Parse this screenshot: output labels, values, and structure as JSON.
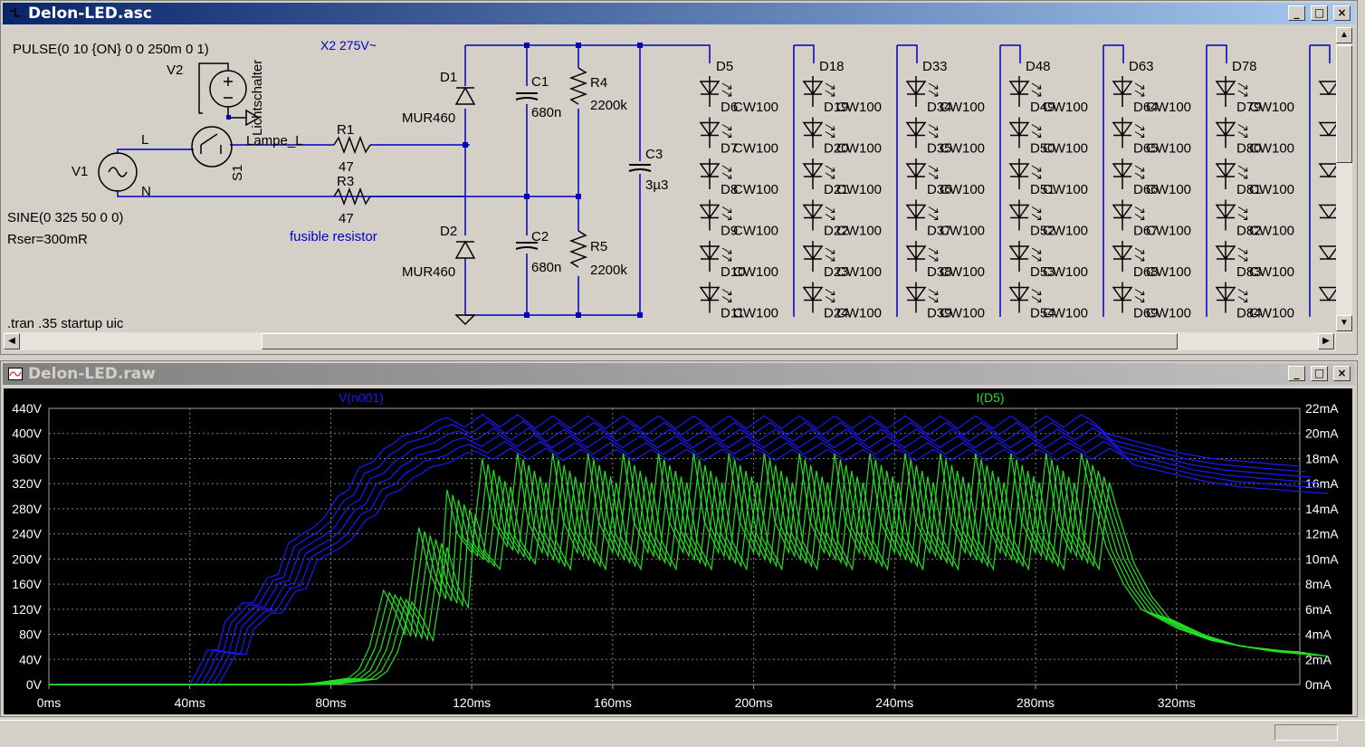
{
  "schematic_window": {
    "title": "Delon-LED.asc",
    "buttons": {
      "minimize": "_",
      "maximize": "□",
      "close": "×"
    }
  },
  "plot_window": {
    "title": "Delon-LED.raw",
    "buttons": {
      "minimize": "_",
      "maximize": "□",
      "close": "×"
    }
  },
  "schematic": {
    "pulse_spec": "PULSE(0 10 {ON} 0 0 250m 0 1)",
    "v2_label": "V2",
    "v1_label": "V1",
    "lichtschalter": "Lichtschalter",
    "lampe_l": "Lampe_L",
    "s1_label": "S1",
    "node_L": "L",
    "node_N": "N",
    "sine_spec": "SINE(0 325 50 0 0)",
    "rser": "Rser=300mR",
    "tran": ".tran .35 startup uic",
    "r1": "R1",
    "r1_val": "47",
    "r3": "R3",
    "r3_val": "47",
    "fusible": "fusible resistor",
    "x2": "X2 275V~",
    "d1": "D1",
    "d1_model": "MUR460",
    "d2": "D2",
    "d2_model": "MUR460",
    "c1": "C1",
    "c1_val": "680n",
    "c2": "C2",
    "c2_val": "680n",
    "r4": "R4",
    "r4_val": "2200k",
    "r5": "R5",
    "r5_val": "2200k",
    "c3": "C3",
    "c3_val": "3µ3",
    "led_model": "CW100",
    "led_columns": [
      {
        "header": "D5",
        "rows": [
          "D6",
          "D7",
          "D8",
          "D9",
          "D10",
          "D11"
        ]
      },
      {
        "header": "D18",
        "rows": [
          "D19",
          "D20",
          "D21",
          "D22",
          "D23",
          "D24"
        ]
      },
      {
        "header": "D33",
        "rows": [
          "D34",
          "D35",
          "D36",
          "D37",
          "D38",
          "D39"
        ]
      },
      {
        "header": "D48",
        "rows": [
          "D49",
          "D50",
          "D51",
          "D52",
          "D53",
          "D54"
        ]
      },
      {
        "header": "D63",
        "rows": [
          "D64",
          "D65",
          "D66",
          "D67",
          "D68",
          "D69"
        ]
      },
      {
        "header": "D78",
        "rows": [
          "D79",
          "D80",
          "D81",
          "D82",
          "D83",
          "D84"
        ]
      }
    ]
  },
  "colors": {
    "plot_bg": "#000000",
    "voltage_trace": "#1a1aff",
    "current_trace": "#22e022",
    "schematic_wire": "#0000c0",
    "axis_text": "#ffffff"
  },
  "chart_data": {
    "type": "line",
    "title": "",
    "xlabel": "",
    "ylabel": "",
    "x_ticks": [
      "0ms",
      "40ms",
      "80ms",
      "120ms",
      "160ms",
      "200ms",
      "240ms",
      "280ms",
      "320ms"
    ],
    "xlim": [
      0,
      355
    ],
    "y_left_ticks": [
      "0V",
      "40V",
      "80V",
      "120V",
      "160V",
      "200V",
      "240V",
      "280V",
      "320V",
      "360V",
      "400V",
      "440V"
    ],
    "ylim_left": [
      0,
      440
    ],
    "y_right_ticks": [
      "0mA",
      "2mA",
      "4mA",
      "6mA",
      "8mA",
      "10mA",
      "12mA",
      "14mA",
      "16mA",
      "18mA",
      "20mA",
      "22mA"
    ],
    "ylim_right": [
      0,
      22
    ],
    "grid": true,
    "series": [
      {
        "name": "V(n001)",
        "axis": "left",
        "x": [
          0,
          40,
          42,
          45,
          48,
          50,
          55,
          58,
          62,
          65,
          68,
          72,
          75,
          78,
          82,
          85,
          88,
          92,
          95,
          98,
          100,
          103,
          106,
          110,
          113,
          118,
          123,
          128,
          133,
          138,
          143,
          148,
          153,
          158,
          163,
          168,
          173,
          178,
          183,
          188,
          193,
          198,
          203,
          208,
          213,
          218,
          223,
          228,
          233,
          238,
          243,
          248,
          253,
          258,
          263,
          268,
          273,
          278,
          283,
          288,
          293,
          296,
          300,
          310,
          320,
          330,
          340,
          350,
          355
        ],
        "values": [
          0,
          0,
          20,
          55,
          55,
          100,
          130,
          130,
          170,
          175,
          225,
          240,
          250,
          265,
          300,
          310,
          345,
          355,
          375,
          385,
          395,
          400,
          405,
          420,
          425,
          410,
          430,
          410,
          430,
          408,
          428,
          408,
          428,
          408,
          428,
          408,
          428,
          408,
          428,
          408,
          428,
          408,
          428,
          408,
          428,
          408,
          428,
          408,
          428,
          408,
          428,
          408,
          428,
          408,
          428,
          408,
          428,
          408,
          428,
          410,
          430,
          420,
          400,
          385,
          370,
          360,
          355,
          350,
          348
        ]
      },
      {
        "name": "I(D5)",
        "axis": "right",
        "x": [
          0,
          70,
          75,
          80,
          85,
          88,
          91,
          95,
          98,
          101,
          105,
          108,
          111,
          113,
          116,
          120,
          123,
          126,
          130,
          133,
          136,
          140,
          143,
          146,
          150,
          153,
          156,
          160,
          163,
          166,
          170,
          173,
          176,
          180,
          183,
          186,
          190,
          193,
          196,
          200,
          203,
          206,
          210,
          213,
          216,
          220,
          223,
          226,
          230,
          233,
          236,
          240,
          243,
          246,
          250,
          253,
          256,
          260,
          263,
          266,
          270,
          273,
          276,
          280,
          283,
          286,
          290,
          293,
          295,
          300,
          305,
          310,
          320,
          330,
          340,
          350,
          355
        ],
        "values": [
          0,
          0,
          0.1,
          0.3,
          0.5,
          1.2,
          3,
          7.5,
          6,
          4,
          12.5,
          9,
          7,
          15.5,
          12,
          10.5,
          18,
          13,
          11,
          18.4,
          13,
          10.5,
          18.4,
          13,
          10.5,
          18.4,
          13,
          10.5,
          18.4,
          13,
          10.5,
          18.4,
          13,
          10.5,
          18.4,
          13,
          10.5,
          18.4,
          13,
          10.5,
          18.4,
          13,
          10.5,
          18.4,
          13,
          10.5,
          18.4,
          13,
          10.5,
          18.4,
          13,
          10.5,
          18.4,
          13,
          10.5,
          18.4,
          13,
          10.5,
          18.4,
          13,
          10.5,
          18.4,
          13,
          10.5,
          18.4,
          13,
          10.5,
          18.4,
          16,
          11,
          8,
          6,
          4.5,
          3.5,
          3,
          2.7,
          2.6
        ]
      }
    ]
  }
}
